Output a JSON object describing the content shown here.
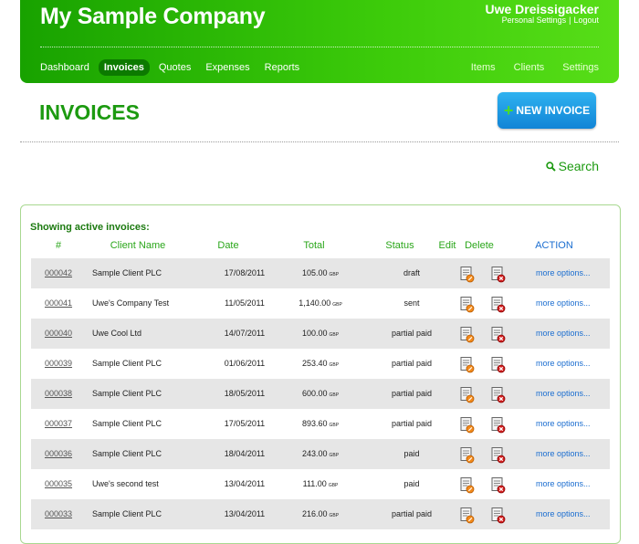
{
  "header": {
    "company": "My Sample Company",
    "user_name": "Uwe Dreissigacker",
    "personal_settings": "Personal Settings",
    "separator": "|",
    "logout": "Logout"
  },
  "nav": {
    "left": [
      {
        "label": "Dashboard",
        "active": false
      },
      {
        "label": "Invoices",
        "active": true
      },
      {
        "label": "Quotes",
        "active": false
      },
      {
        "label": "Expenses",
        "active": false
      },
      {
        "label": "Reports",
        "active": false
      }
    ],
    "right": [
      {
        "label": "Items"
      },
      {
        "label": "Clients"
      },
      {
        "label": "Settings"
      }
    ]
  },
  "page": {
    "title": "INVOICES",
    "new_invoice_label": "NEW INVOICE",
    "search_label": "Search"
  },
  "table": {
    "caption": "Showing active invoices:",
    "headers": {
      "num": "#",
      "client": "Client Name",
      "date": "Date",
      "total": "Total",
      "status": "Status",
      "edit": "Edit",
      "delete": "Delete",
      "action": "ACTION"
    },
    "currency": "GBP",
    "more_label": "more options...",
    "rows": [
      {
        "num": "000042",
        "client": "Sample Client PLC",
        "date": "17/08/2011",
        "total": "105.00",
        "status": "draft"
      },
      {
        "num": "000041",
        "client": "Uwe's Company Test",
        "date": "11/05/2011",
        "total": "1,140.00",
        "status": "sent"
      },
      {
        "num": "000040",
        "client": "Uwe Cool Ltd",
        "date": "14/07/2011",
        "total": "100.00",
        "status": "partial paid"
      },
      {
        "num": "000039",
        "client": "Sample Client PLC",
        "date": "01/06/2011",
        "total": "253.40",
        "status": "partial paid"
      },
      {
        "num": "000038",
        "client": "Sample Client PLC",
        "date": "18/05/2011",
        "total": "600.00",
        "status": "partial paid"
      },
      {
        "num": "000037",
        "client": "Sample Client PLC",
        "date": "17/05/2011",
        "total": "893.60",
        "status": "partial paid"
      },
      {
        "num": "000036",
        "client": "Sample Client PLC",
        "date": "18/04/2011",
        "total": "243.00",
        "status": "paid"
      },
      {
        "num": "000035",
        "client": "Uwe's second test",
        "date": "13/04/2011",
        "total": "111.00",
        "status": "paid"
      },
      {
        "num": "000033",
        "client": "Sample Client PLC",
        "date": "13/04/2011",
        "total": "216.00",
        "status": "partial paid"
      }
    ]
  },
  "icons": {
    "edit": "edit-document-icon",
    "delete": "delete-document-icon",
    "search": "magnifier-icon",
    "new": "plus-icon"
  },
  "colors": {
    "header_green": "#18a200",
    "title_green": "#1c9a10",
    "button_blue": "#1184d6",
    "link_blue": "#1a6dd0"
  }
}
